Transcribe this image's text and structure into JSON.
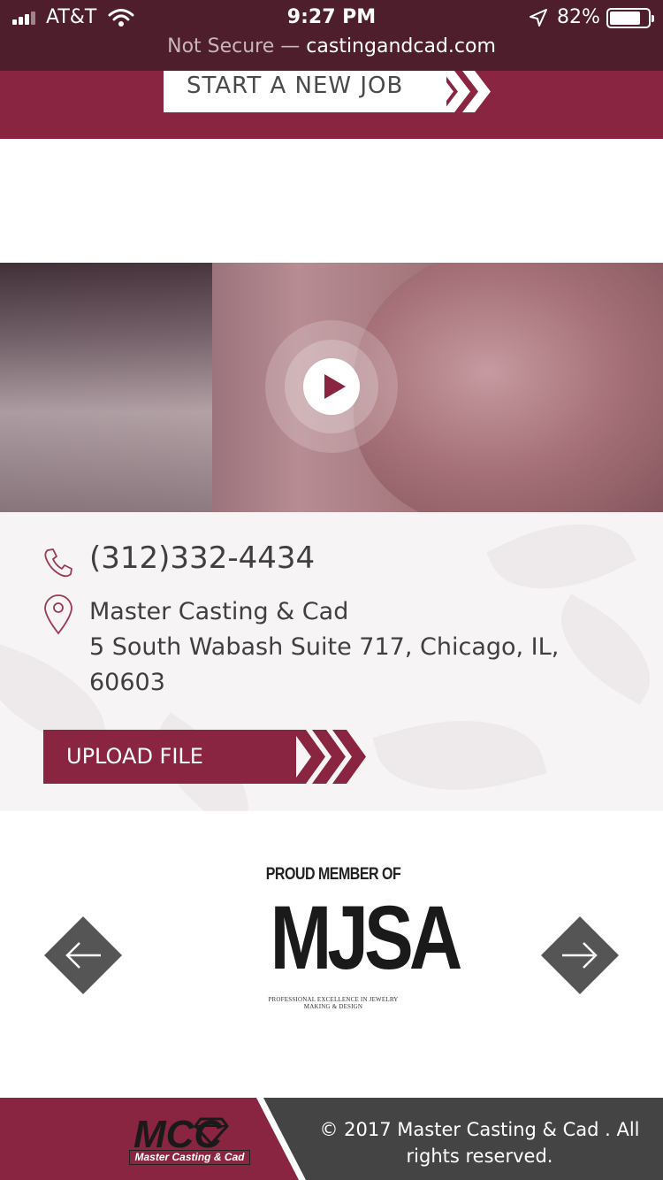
{
  "status_bar": {
    "carrier": "AT&T",
    "time": "9:27 PM",
    "battery_percent": "82%",
    "battery_level": 0.82,
    "icons": [
      "signal-icon",
      "wifi-icon",
      "location-icon",
      "battery-icon"
    ]
  },
  "url_bar": {
    "security": "Not Secure",
    "separator": " — ",
    "domain": "castingandcad.com"
  },
  "header": {
    "new_job_label": "START A NEW JOB"
  },
  "video": {
    "play_icon": "play-icon"
  },
  "contact": {
    "phone": "(312)332-4434",
    "company": "Master Casting & Cad",
    "address_line": "5 South Wabash Suite 717, Chicago, IL,",
    "zip": "60603",
    "upload_label": "UPLOAD FILE"
  },
  "carousel": {
    "prev_icon": "arrow-left-icon",
    "next_icon": "arrow-right-icon",
    "badge_top": "PROUD MEMBER OF",
    "badge_main": "MJSA",
    "badge_tagline": "PROFESSIONAL EXCELLENCE IN JEWELRY MAKING & DESIGN"
  },
  "footer": {
    "logo_letters": "MCC",
    "logo_caption": "Master Casting & Cad",
    "copyright": "© 2017 Master Casting & Cad . All rights reserved."
  },
  "colors": {
    "brand": "#8a2541",
    "topbar": "#4e1e2c",
    "footer_dark": "#444444",
    "arrow_button": "#555555"
  }
}
